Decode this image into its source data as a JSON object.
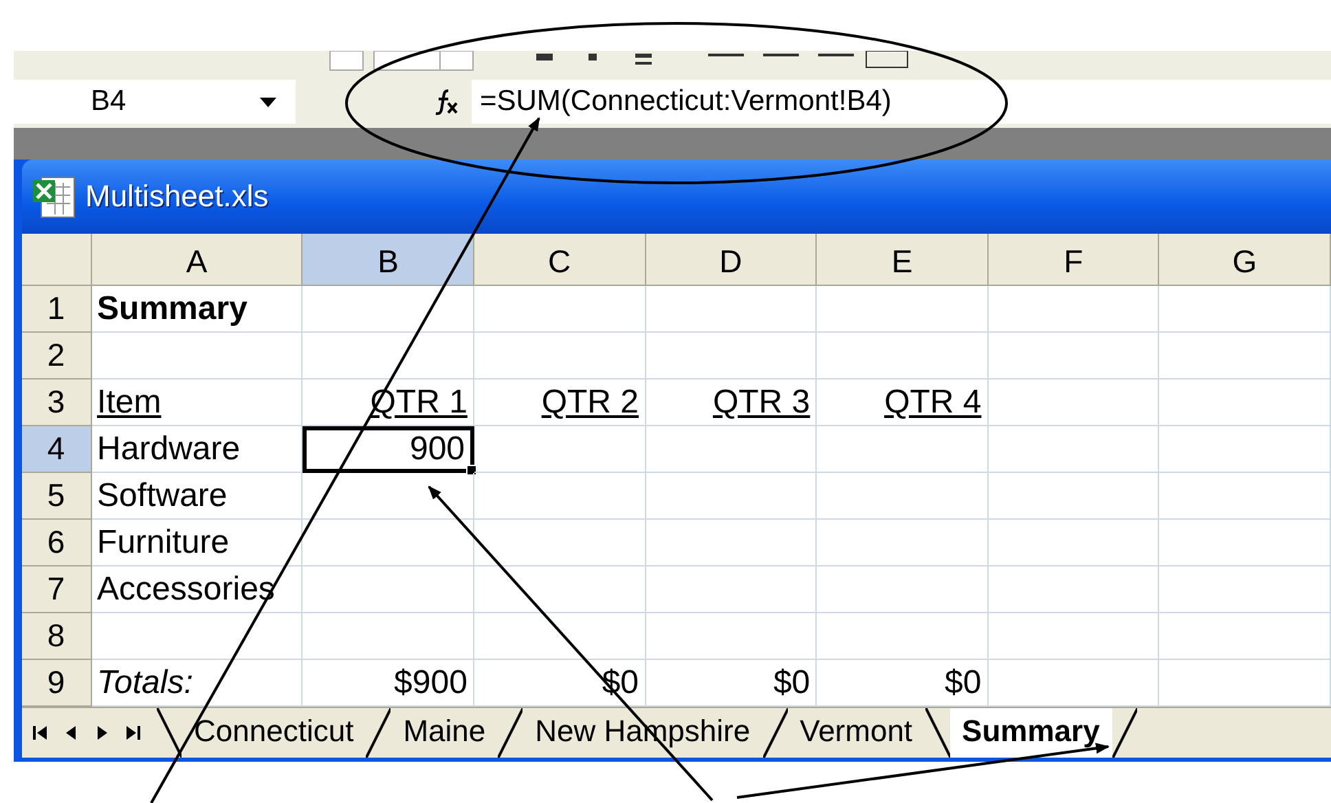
{
  "name_box": {
    "value": "B4"
  },
  "formula_bar": {
    "value": "=SUM(Connecticut:Vermont!B4)"
  },
  "window": {
    "title": "Multisheet.xls"
  },
  "columns": [
    {
      "label": "A",
      "selected": false
    },
    {
      "label": "B",
      "selected": true
    },
    {
      "label": "C",
      "selected": false
    },
    {
      "label": "D",
      "selected": false
    },
    {
      "label": "E",
      "selected": false
    },
    {
      "label": "F",
      "selected": false
    },
    {
      "label": "G",
      "selected": false
    }
  ],
  "rows": [
    {
      "number": "1",
      "kind": "title",
      "selected": false,
      "cells": [
        "Summary"
      ]
    },
    {
      "number": "2",
      "kind": "blank",
      "selected": false,
      "cells": []
    },
    {
      "number": "3",
      "kind": "header",
      "selected": false,
      "cells": [
        "Item",
        "QTR 1",
        "QTR 2",
        "QTR 3",
        "QTR 4"
      ]
    },
    {
      "number": "4",
      "kind": "item",
      "selected": true,
      "cells": [
        "Hardware",
        "900"
      ]
    },
    {
      "number": "5",
      "kind": "item",
      "selected": false,
      "cells": [
        "Software"
      ]
    },
    {
      "number": "6",
      "kind": "item",
      "selected": false,
      "cells": [
        "Furniture"
      ]
    },
    {
      "number": "7",
      "kind": "item",
      "selected": false,
      "cells": [
        "Accessories"
      ]
    },
    {
      "number": "8",
      "kind": "blank",
      "selected": false,
      "cells": []
    },
    {
      "number": "9",
      "kind": "total",
      "selected": false,
      "cells": [
        "Totals:",
        "$900",
        "$0",
        "$0",
        "$0"
      ]
    }
  ],
  "sheet_tabs": [
    {
      "label": "Connecticut",
      "selected": false
    },
    {
      "label": "Maine",
      "selected": false
    },
    {
      "label": "New Hampshire",
      "selected": false
    },
    {
      "label": "Vermont",
      "selected": false
    },
    {
      "label": "Summary",
      "selected": true
    }
  ]
}
